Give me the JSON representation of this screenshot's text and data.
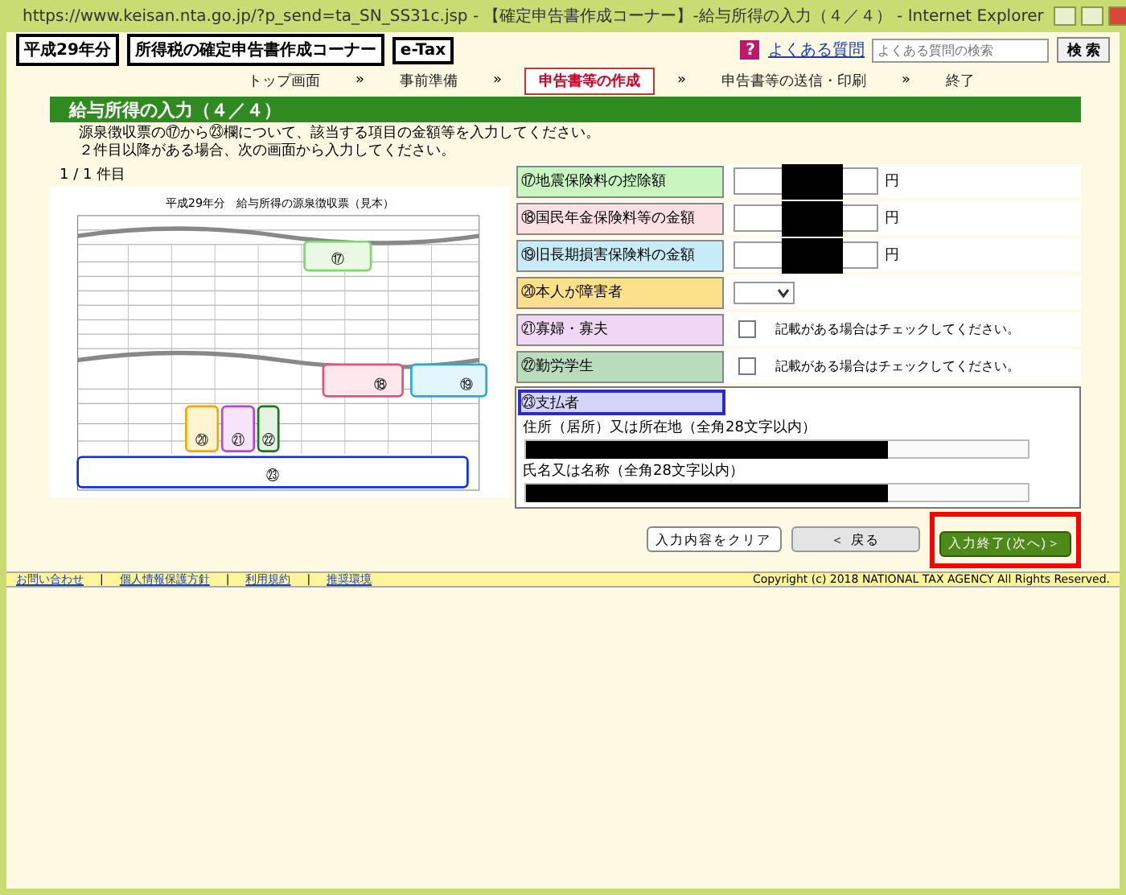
{
  "window": {
    "title": "https://www.keisan.nta.go.jp/?p_send=ta_SN_SS31c.jsp - 【確定申告書作成コーナー】-給与所得の入力（４／４） - Internet Explorer"
  },
  "header": {
    "badges": [
      "平成29年分",
      "所得税の確定申告書作成コーナー",
      "e-Tax"
    ],
    "help_glyph": "?",
    "faq_link": "よくある質問",
    "search": {
      "placeholder": "よくある質問の検索"
    },
    "search_button": "検 索"
  },
  "steps": [
    {
      "label": "トップ画面",
      "selected": false
    },
    {
      "label": "事前準備",
      "selected": false
    },
    {
      "label": "申告書等の作成",
      "selected": true
    },
    {
      "label": "申告書等の送信・印刷",
      "selected": false
    },
    {
      "label": "終了",
      "selected": false
    }
  ],
  "step_separator": "»",
  "heading": "給与所得の入力（４／４）",
  "instructions": [
    "源泉徴収票の⑰から㉓欄について、該当する項目の金額等を入力してください。",
    "２件目以降がある場合、次の画面から入力してください。"
  ],
  "counter": "1 / 1 件目",
  "form_image": {
    "title": "平成29年分　給与所得の源泉徴収票（見本）",
    "markers": [
      "⑰",
      "⑱",
      "⑲",
      "⑳",
      "㉑",
      "㉒",
      "㉓"
    ]
  },
  "fields": [
    {
      "kind": "amount",
      "label": "⑰地震保険料の控除額",
      "color": "#c8f5c0",
      "unit": "円"
    },
    {
      "kind": "amount",
      "label": "⑱国民年金保険料等の金額",
      "color": "#fde0e4",
      "unit": "円"
    },
    {
      "kind": "amount",
      "label": "⑲旧長期損害保険料の金額",
      "color": "#c7ecf8",
      "unit": "円"
    },
    {
      "kind": "select",
      "label": "⑳本人が障害者",
      "color": "#fde08a"
    },
    {
      "kind": "check",
      "label": "㉑寡婦・寡夫",
      "color": "#f0d8f5",
      "checked": false,
      "hint": "記載がある場合はチェックしてください。"
    },
    {
      "kind": "check",
      "label": "㉒勤労学生",
      "color": "#b8dcbc",
      "checked": false,
      "hint": "記載がある場合はチェックしてください。"
    }
  ],
  "payer": {
    "label": "㉓支払者",
    "address_label": "住所（居所）又は所在地（全角28文字以内）",
    "name_label": "氏名又は名称（全角28文字以内）"
  },
  "buttons": [
    {
      "label": "入力内容をクリア",
      "kind": "clear"
    },
    {
      "label": "＜ 戻る",
      "kind": "back"
    },
    {
      "label": "入力終了(次へ)＞",
      "kind": "next"
    }
  ],
  "footer": {
    "separator": "|",
    "links": [
      "お問い合わせ",
      "個人情報保護方針",
      "利用規約",
      "推奨環境"
    ],
    "copyright": "Copyright (c) 2018 NATIONAL TAX AGENCY All Rights Reserved."
  }
}
